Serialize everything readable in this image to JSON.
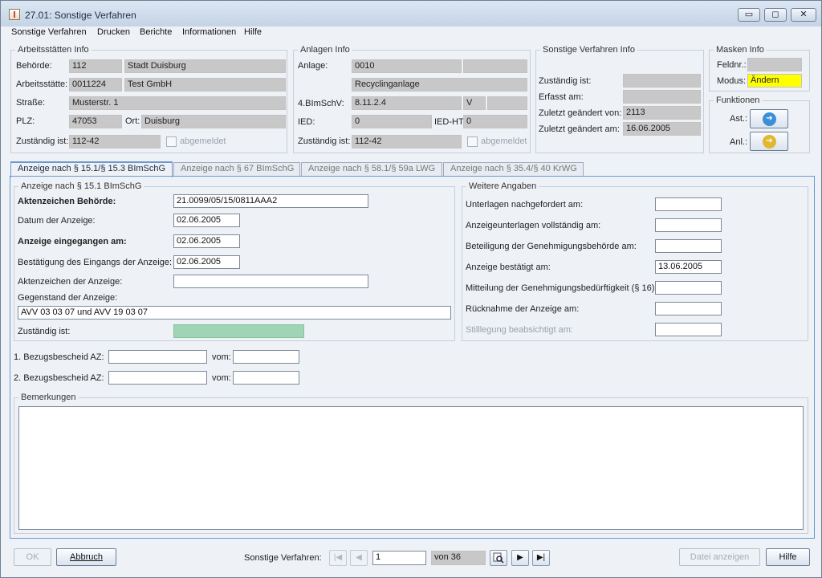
{
  "window": {
    "title": "27.01: Sonstige Verfahren",
    "minimize": "▭",
    "maximize": "◻",
    "close": "✕"
  },
  "menu": [
    "Sonstige Verfahren",
    "Drucken",
    "Berichte",
    "Informationen",
    "Hilfe"
  ],
  "arbeitsstaetten": {
    "legend": "Arbeitsstätten Info",
    "behoerde_label": "Behörde:",
    "behoerde_code": "112",
    "behoerde_name": "Stadt Duisburg",
    "arbeitsstaette_label": "Arbeitsstätte:",
    "arbeitsstaette_code": "0011224",
    "arbeitsstaette_name": "Test GmbH",
    "strasse_label": "Straße:",
    "strasse": "Musterstr. 1",
    "plz_label": "PLZ:",
    "plz": "47053",
    "ort_label": "Ort:",
    "ort": "Duisburg",
    "zustaendig_label": "Zuständig ist:",
    "zustaendig": "112-42",
    "abgemeldet_label": "abgemeldet"
  },
  "anlagen": {
    "legend": "Anlagen Info",
    "anlage_label": "Anlage:",
    "anlage": "0010",
    "anlage_name": "Recyclinganlage",
    "bimschv_label": "4.BImSchV:",
    "bimschv": "8.11.2.4",
    "bimschv_v": "V",
    "ied_label": "IED:",
    "ied": "0",
    "iedht_label": "IED-HT:",
    "iedht": "0",
    "zustaendig_label": "Zuständig ist:",
    "zustaendig": "112-42",
    "abgemeldet_label": "abgemeldet"
  },
  "sv_info": {
    "legend": "Sonstige Verfahren Info",
    "zustaendig_label": "Zuständig ist:",
    "erfasst_label": "Erfasst am:",
    "geaendert_von_label": "Zuletzt geändert von:",
    "geaendert_von": "2113",
    "geaendert_am_label": "Zuletzt geändert am:",
    "geaendert_am": "16.06.2005"
  },
  "masken": {
    "legend": "Masken Info",
    "feldnr_label": "Feldnr.:",
    "modus_label": "Modus:",
    "modus": "Ändern",
    "modus_color": "#ffff00"
  },
  "funktionen": {
    "legend": "Funktionen",
    "ast_label": "Ast.:",
    "anl_label": "Anl.:",
    "ast_color": "#3a8fd8",
    "anl_color": "#e0b830"
  },
  "tabs": [
    "Anzeige nach § 15.1/§ 15.3 BImSchG",
    "Anzeige nach § 67 BImSchG",
    "Anzeige nach § 58.1/§ 59a LWG",
    "Anzeige nach § 35.4/§ 40 KrWG"
  ],
  "anzeige": {
    "legend": "Anzeige nach § 15.1 BImSchG",
    "az_behoerde_label": "Aktenzeichen Behörde:",
    "az_behoerde": "21.0099/05/15/0811AAA2",
    "datum_label": "Datum der Anzeige:",
    "datum": "02.06.2005",
    "eingegangen_label": "Anzeige eingegangen am:",
    "eingegangen": "02.06.2005",
    "bestaetigung_label": "Bestätigung des Eingangs der Anzeige:",
    "bestaetigung": "02.06.2005",
    "az_anzeige_label": "Aktenzeichen der Anzeige:",
    "az_anzeige": "",
    "gegenstand_label": "Gegenstand der Anzeige:",
    "gegenstand": "AVV 03 03 07 und AVV 19 03 07",
    "zustaendig_label": "Zuständig ist:",
    "zustaendig_color": "#9fd4b4"
  },
  "weitere": {
    "legend": "Weitere Angaben",
    "unterlagen_label": "Unterlagen nachgefordert am:",
    "unterlagen": "",
    "vollstaendig_label": "Anzeigeunterlagen vollständig am:",
    "vollstaendig": "",
    "beteiligung_label": "Beteiligung der Genehmigungsbehörde am:",
    "beteiligung": "",
    "bestaetigt_label": "Anzeige bestätigt am:",
    "bestaetigt": "13.06.2005",
    "mitteilung_label": "Mitteilung der Genehmigungsbedürftigkeit (§ 16):",
    "mitteilung": "",
    "ruecknahme_label": "Rücknahme der Anzeige am:",
    "ruecknahme": "",
    "stilllegung_label": "Stilllegung beabsichtigt am:",
    "stilllegung": ""
  },
  "bezug": {
    "az1_label": "1. Bezugsbescheid AZ:",
    "az2_label": "2. Bezugsbescheid AZ:",
    "vom_label": "vom:"
  },
  "bemerkungen": {
    "legend": "Bemerkungen",
    "text": ""
  },
  "footer": {
    "ok": "OK",
    "abbruch": "Abbruch",
    "nav_label": "Sonstige Verfahren:",
    "record": "1",
    "of_total": "von 36",
    "first": "|◀",
    "prev": "◀",
    "next": "▶",
    "last": "▶|",
    "datei": "Datei anzeigen",
    "hilfe": "Hilfe"
  }
}
